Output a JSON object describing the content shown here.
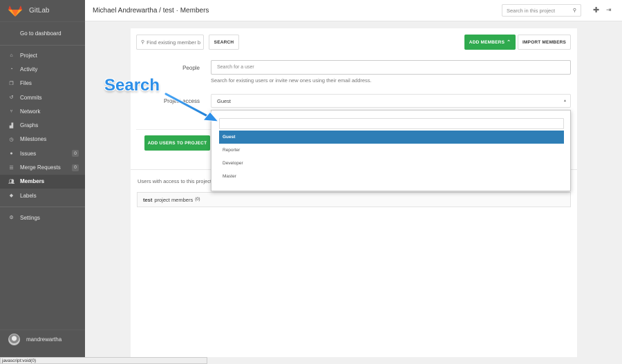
{
  "brand": {
    "name": "GitLab"
  },
  "sidebar": {
    "dashboard_link": "Go to dashboard",
    "items": [
      {
        "label": "Project",
        "icon": "home-icon"
      },
      {
        "label": "Activity",
        "icon": "dashboard-icon"
      },
      {
        "label": "Files",
        "icon": "files-icon"
      },
      {
        "label": "Commits",
        "icon": "history-icon"
      },
      {
        "label": "Network",
        "icon": "code-fork-icon"
      },
      {
        "label": "Graphs",
        "icon": "area-chart-icon"
      },
      {
        "label": "Milestones",
        "icon": "clock-icon"
      },
      {
        "label": "Issues",
        "icon": "exclamation-circle-icon",
        "badge": "0"
      },
      {
        "label": "Merge Requests",
        "icon": "tasks-icon",
        "badge": "0"
      },
      {
        "label": "Members",
        "icon": "users-icon",
        "active": true
      },
      {
        "label": "Labels",
        "icon": "tags-icon"
      }
    ],
    "settings": {
      "label": "Settings",
      "icon": "cogs-icon"
    },
    "user": {
      "name": "mandrewartha"
    }
  },
  "header": {
    "title": "Michael Andrewartha / test · Members",
    "search_placeholder": "Search in this project",
    "plus_icon": "plus-icon",
    "signout_icon": "sign-out-icon"
  },
  "toolbar": {
    "find_placeholder": "Find existing member b",
    "search_button": "SEARCH",
    "add_members_button": "ADD MEMBERS",
    "import_members_button": "IMPORT MEMBERS"
  },
  "form": {
    "people_label": "People",
    "people_placeholder": "Search for a user",
    "people_hint": "Search for existing users or invite new ones using their email address.",
    "access_label": "Project access",
    "access_value": "Guest",
    "add_users_button": "ADD USERS TO PROJECT"
  },
  "dropdown": {
    "options": [
      "Guest",
      "Reporter",
      "Developer",
      "Master"
    ],
    "selected": "Guest"
  },
  "members": {
    "intro": "Users with access to this project",
    "project_name": "test",
    "box_label": "project members",
    "count": "(0)"
  },
  "annotation": {
    "text": "Search",
    "color": "#2d8fe8"
  },
  "statusbar": {
    "text": "javascript:void(0)"
  },
  "colors": {
    "sidebar": "#565656",
    "green": "#2faa4e",
    "selected": "#2e7eb6"
  }
}
